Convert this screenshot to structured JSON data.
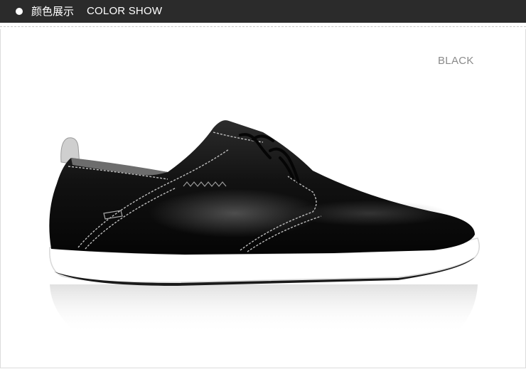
{
  "header": {
    "title_cn": "颜色展示",
    "title_en": "COLOR SHOW"
  },
  "product": {
    "color_label": "BLACK",
    "image_icon": "black-leather-shoe-image"
  },
  "colors": {
    "header_bg": "#2b2b2b",
    "shoe_leather": "#111111",
    "sole": "#ffffff",
    "stitching": "#bdbdbd"
  }
}
